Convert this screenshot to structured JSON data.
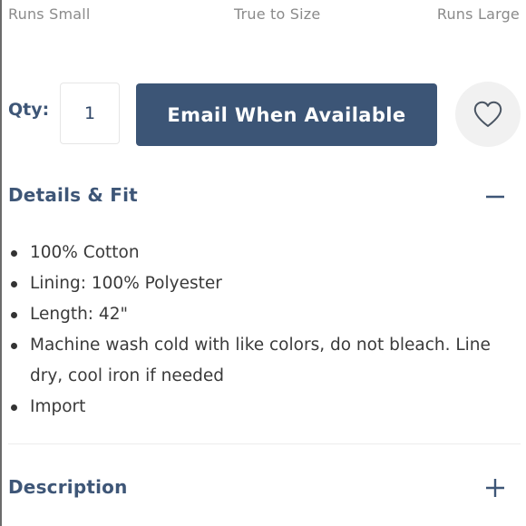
{
  "fit_scale": {
    "left": "Runs Small",
    "middle": "True to Size",
    "right": "Runs Large"
  },
  "purchase": {
    "qty_label": "Qty:",
    "qty_value": "1",
    "email_button": "Email When Available",
    "wishlist_icon": "heart-outline-icon"
  },
  "details": {
    "title": "Details & Fit",
    "toggle_icon": "minus-icon",
    "items": [
      "100% Cotton",
      "Lining: 100% Polyester",
      "Length: 42\"",
      "Machine wash cold with like colors, do not bleach. Line dry, cool iron if needed",
      "Import"
    ]
  },
  "description": {
    "title": "Description",
    "toggle_icon": "plus-icon"
  },
  "colors": {
    "accent": "#3c5576",
    "heading": "#3e5677",
    "muted_text": "#8a8a8a",
    "body_text": "#3a3a3a",
    "wishlist_bg": "#f1f1f1"
  }
}
